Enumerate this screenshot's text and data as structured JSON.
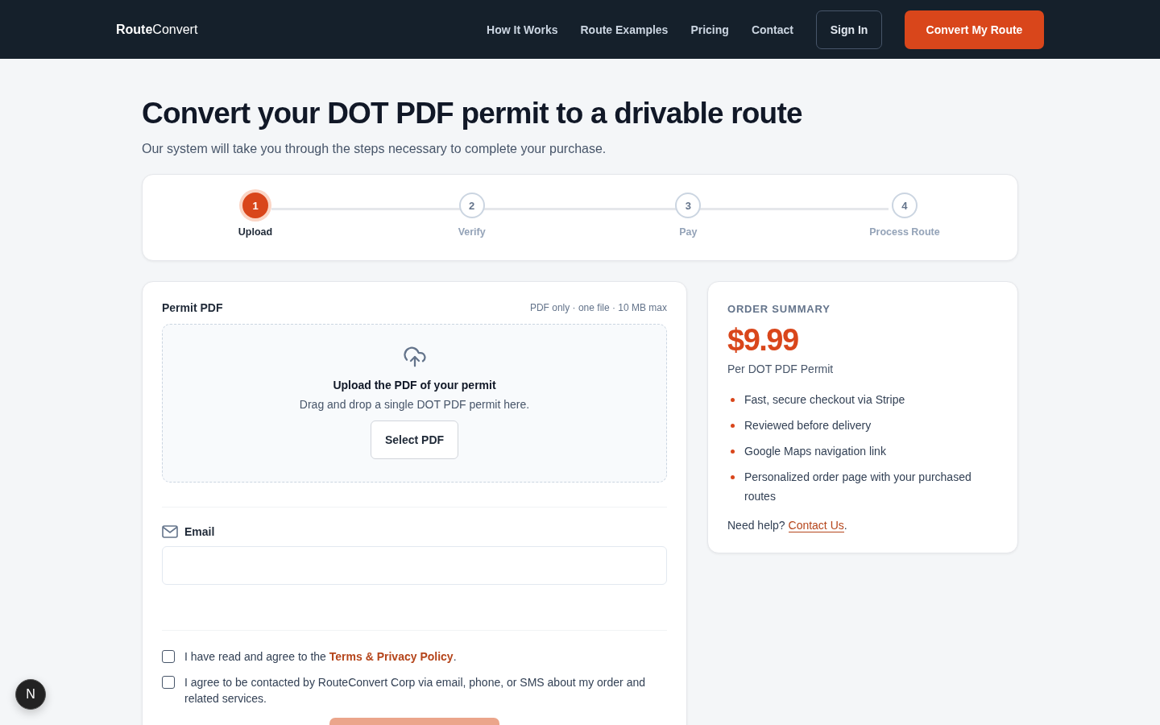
{
  "header": {
    "logo": "**Route**Convert",
    "nav": [
      "How It Works",
      "Route Examples",
      "Pricing",
      "Contact"
    ],
    "sign_in": "Sign In",
    "cta": "Convert My Route"
  },
  "page": {
    "title": "Convert your DOT PDF permit to a drivable route",
    "subtitle": "Our system will take you through the steps necessary to complete your purchase."
  },
  "steps": [
    {
      "number": "1",
      "label": "Upload",
      "selected": true
    },
    {
      "number": "2",
      "label": "Verify",
      "selected": false
    },
    {
      "number": "3",
      "label": "Pay",
      "selected": false
    },
    {
      "number": "4",
      "label": "Process Route",
      "selected": false
    }
  ],
  "upload": {
    "label": "Permit PDF",
    "hint": "PDF only · one file · 10 MB max",
    "drop_title": "Upload the PDF of your permit",
    "drop_text": "Drag and drop a single DOT PDF permit here.",
    "button": "Select PDF"
  },
  "email": {
    "label": "Email"
  },
  "consents": [
    {
      "text": "I have read and agree to the ",
      "link": "Terms & Privacy Policy",
      "after": ".",
      "checked": false
    },
    {
      "text": "I agree to be contacted by RouteConvert Corp via email, phone, or SMS about my order and related services.",
      "checked": false
    }
  ],
  "submit_button": {
    "disabled": true
  },
  "summary": {
    "heading": "ORDER SUMMARY",
    "price": "$9.99",
    "price_note": "Per DOT PDF Permit",
    "features": [
      "Fast, secure checkout via Stripe",
      "Reviewed before delivery",
      "Google Maps navigation link",
      "Personalized order page with your purchased routes"
    ],
    "help": "Need help? ",
    "help_link": "Contact Us",
    "help_after": "."
  },
  "dev_badge": "N"
}
